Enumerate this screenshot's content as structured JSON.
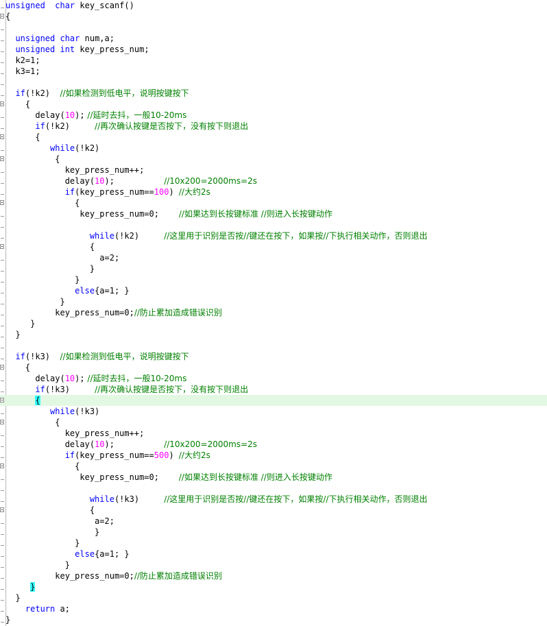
{
  "lines": [
    {
      "segs": [
        [
          "kw",
          "unsigned"
        ],
        [
          "",
          "  "
        ],
        [
          "kw",
          "char"
        ],
        [
          "",
          " key_scanf()"
        ]
      ],
      "fold": false
    },
    {
      "segs": [
        [
          "",
          "{"
        ]
      ],
      "fold": true
    },
    {
      "segs": [
        [
          "",
          ""
        ]
      ],
      "fold": false
    },
    {
      "segs": [
        [
          "",
          "  "
        ],
        [
          "kw",
          "unsigned"
        ],
        [
          "",
          " "
        ],
        [
          "kw",
          "char"
        ],
        [
          "",
          " num,a;"
        ]
      ],
      "fold": false
    },
    {
      "segs": [
        [
          "",
          "  "
        ],
        [
          "kw",
          "unsigned"
        ],
        [
          "",
          " "
        ],
        [
          "kw",
          "int"
        ],
        [
          "",
          " key_press_num;"
        ]
      ],
      "fold": false
    },
    {
      "segs": [
        [
          "",
          "  k2=1;"
        ]
      ],
      "fold": false
    },
    {
      "segs": [
        [
          "",
          "  k3=1;"
        ]
      ],
      "fold": false
    },
    {
      "segs": [
        [
          "",
          ""
        ]
      ],
      "fold": false
    },
    {
      "segs": [
        [
          "",
          "  "
        ],
        [
          "kw",
          "if"
        ],
        [
          "",
          "(!k2)  "
        ],
        [
          "cm",
          "//如果检测到低电平，说明按键按下"
        ]
      ],
      "fold": false
    },
    {
      "segs": [
        [
          "",
          "    {"
        ]
      ],
      "fold": true
    },
    {
      "segs": [
        [
          "",
          "      delay("
        ],
        [
          "num",
          "10"
        ],
        [
          "",
          ");"
        ],
        [
          "cm",
          " //延时去抖，一般10-20ms"
        ]
      ],
      "fold": false
    },
    {
      "segs": [
        [
          "",
          "      "
        ],
        [
          "kw",
          "if"
        ],
        [
          "",
          "(!k2)     "
        ],
        [
          "cm",
          "//再次确认按键是否按下，没有按下则退出"
        ]
      ],
      "fold": false
    },
    {
      "segs": [
        [
          "",
          "      {"
        ]
      ],
      "fold": true
    },
    {
      "segs": [
        [
          "",
          "         "
        ],
        [
          "kw",
          "while"
        ],
        [
          "",
          "(!k2)"
        ]
      ],
      "fold": false
    },
    {
      "segs": [
        [
          "",
          "          {"
        ]
      ],
      "fold": true
    },
    {
      "segs": [
        [
          "",
          "            key_press_num++;"
        ]
      ],
      "fold": false
    },
    {
      "segs": [
        [
          "",
          "            delay("
        ],
        [
          "num",
          "10"
        ],
        [
          "",
          ");          "
        ],
        [
          "cm",
          "//10x200=2000ms=2s"
        ]
      ],
      "fold": false
    },
    {
      "segs": [
        [
          "",
          "            "
        ],
        [
          "kw",
          "if"
        ],
        [
          "",
          "(key_press_num=="
        ],
        [
          "num",
          "100"
        ],
        [
          "",
          ") "
        ],
        [
          "cm",
          "//大约2s"
        ]
      ],
      "fold": false
    },
    {
      "segs": [
        [
          "",
          "              {"
        ]
      ],
      "fold": true
    },
    {
      "segs": [
        [
          "",
          "               key_press_num=0;    "
        ],
        [
          "cm",
          "//如果达到长按键标准 //则进入长按键动作"
        ]
      ],
      "fold": false
    },
    {
      "segs": [
        [
          "",
          ""
        ]
      ],
      "fold": false
    },
    {
      "segs": [
        [
          "",
          "                 "
        ],
        [
          "kw",
          "while"
        ],
        [
          "",
          "(!k2)     "
        ],
        [
          "cm",
          "//这里用于识别是否按//键还在按下，如果按//下执行相关动作，否则退出"
        ]
      ],
      "fold": false
    },
    {
      "segs": [
        [
          "",
          "                 {"
        ]
      ],
      "fold": true
    },
    {
      "segs": [
        [
          "",
          "                   a=2;"
        ]
      ],
      "fold": false
    },
    {
      "segs": [
        [
          "",
          "                 }"
        ]
      ],
      "fold": false
    },
    {
      "segs": [
        [
          "",
          "              }"
        ]
      ],
      "fold": false
    },
    {
      "segs": [
        [
          "",
          "              "
        ],
        [
          "kw",
          "else"
        ],
        [
          "",
          "{a=1; }"
        ]
      ],
      "fold": false
    },
    {
      "segs": [
        [
          "",
          "           }"
        ]
      ],
      "fold": false
    },
    {
      "segs": [
        [
          "",
          "          key_press_num=0;"
        ],
        [
          "cm",
          "//防止累加造成错误识别"
        ]
      ],
      "fold": false
    },
    {
      "segs": [
        [
          "",
          "     }"
        ]
      ],
      "fold": false
    },
    {
      "segs": [
        [
          "",
          "  }"
        ]
      ],
      "fold": false
    },
    {
      "segs": [
        [
          "",
          ""
        ]
      ],
      "fold": false
    },
    {
      "segs": [
        [
          "",
          "  "
        ],
        [
          "kw",
          "if"
        ],
        [
          "",
          "(!k3)  "
        ],
        [
          "cm",
          "//如果检测到低电平，说明按键按下"
        ]
      ],
      "fold": false
    },
    {
      "segs": [
        [
          "",
          "    {"
        ]
      ],
      "fold": true
    },
    {
      "segs": [
        [
          "",
          "      delay("
        ],
        [
          "num",
          "10"
        ],
        [
          "",
          ");"
        ],
        [
          "cm",
          " //延时去抖，一般10-20ms"
        ]
      ],
      "fold": false
    },
    {
      "segs": [
        [
          "",
          "      "
        ],
        [
          "kw",
          "if"
        ],
        [
          "",
          "(!k3)     "
        ],
        [
          "cm",
          "//再次确认按键是否按下，没有按下则退出"
        ]
      ],
      "fold": false
    },
    {
      "segs": [
        [
          "",
          "      "
        ],
        [
          "bm",
          "{"
        ]
      ],
      "fold": true,
      "current": true
    },
    {
      "segs": [
        [
          "",
          "         "
        ],
        [
          "kw",
          "while"
        ],
        [
          "",
          "(!k3)"
        ]
      ],
      "fold": false
    },
    {
      "segs": [
        [
          "",
          "          {"
        ]
      ],
      "fold": true
    },
    {
      "segs": [
        [
          "",
          "            key_press_num++;"
        ]
      ],
      "fold": false
    },
    {
      "segs": [
        [
          "",
          "            delay("
        ],
        [
          "num",
          "10"
        ],
        [
          "",
          ");          "
        ],
        [
          "cm",
          "//10x200=2000ms=2s"
        ]
      ],
      "fold": false
    },
    {
      "segs": [
        [
          "",
          "            "
        ],
        [
          "kw",
          "if"
        ],
        [
          "",
          "(key_press_num=="
        ],
        [
          "num",
          "500"
        ],
        [
          "",
          ") "
        ],
        [
          "cm",
          "//大约2s"
        ]
      ],
      "fold": false
    },
    {
      "segs": [
        [
          "",
          "              {"
        ]
      ],
      "fold": true
    },
    {
      "segs": [
        [
          "",
          "               key_press_num=0;    "
        ],
        [
          "cm",
          "//如果达到长按键标准 //则进入长按键动作"
        ]
      ],
      "fold": false
    },
    {
      "segs": [
        [
          "",
          ""
        ]
      ],
      "fold": false
    },
    {
      "segs": [
        [
          "",
          "                 "
        ],
        [
          "kw",
          "while"
        ],
        [
          "",
          "(!k3)     "
        ],
        [
          "cm",
          "//这里用于识别是否按//键还在按下，如果按//下执行相关动作，否则退出"
        ]
      ],
      "fold": false
    },
    {
      "segs": [
        [
          "",
          "                 {"
        ]
      ],
      "fold": true
    },
    {
      "segs": [
        [
          "",
          "                  a=2;"
        ]
      ],
      "fold": false
    },
    {
      "segs": [
        [
          "",
          "                  }"
        ]
      ],
      "fold": false
    },
    {
      "segs": [
        [
          "",
          "              }"
        ]
      ],
      "fold": false
    },
    {
      "segs": [
        [
          "",
          "              "
        ],
        [
          "kw",
          "else"
        ],
        [
          "",
          "{a=1; }"
        ]
      ],
      "fold": false
    },
    {
      "segs": [
        [
          "",
          "            }"
        ]
      ],
      "fold": false
    },
    {
      "segs": [
        [
          "",
          "          key_press_num=0;"
        ],
        [
          "cm",
          "//防止累加造成错误识别"
        ]
      ],
      "fold": false
    },
    {
      "segs": [
        [
          "",
          "     "
        ],
        [
          "bm",
          "}"
        ]
      ],
      "fold": false
    },
    {
      "segs": [
        [
          "",
          "  }"
        ]
      ],
      "fold": false
    },
    {
      "segs": [
        [
          "",
          "    "
        ],
        [
          "kw",
          "return"
        ],
        [
          "",
          " a;"
        ]
      ],
      "fold": false
    },
    {
      "segs": [
        [
          "",
          "}"
        ]
      ],
      "fold": false
    }
  ]
}
